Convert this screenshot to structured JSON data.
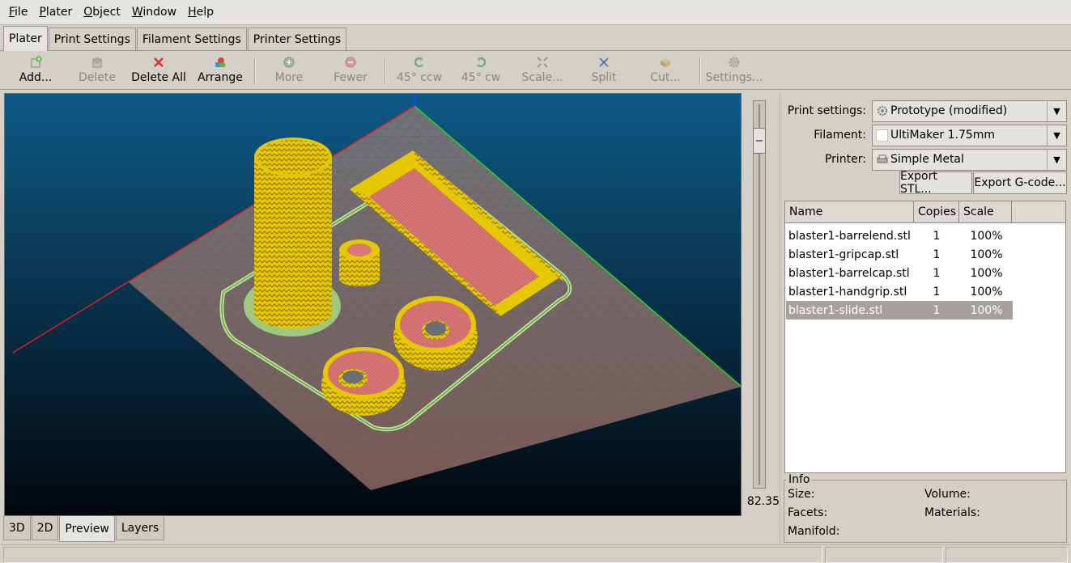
{
  "menu": [
    {
      "u": "F",
      "rest": "ile"
    },
    {
      "u": "P",
      "rest": "later"
    },
    {
      "u": "O",
      "rest": "bject"
    },
    {
      "u": "W",
      "rest": "indow"
    },
    {
      "u": "H",
      "rest": "elp"
    }
  ],
  "top_tabs": [
    "Plater",
    "Print Settings",
    "Filament Settings",
    "Printer Settings"
  ],
  "toolbar": {
    "add": "Add...",
    "delete": "Delete",
    "delete_all": "Delete All",
    "arrange": "Arrange",
    "more": "More",
    "fewer": "Fewer",
    "rot_ccw": "45° ccw",
    "rot_cw": "45° cw",
    "scale": "Scale...",
    "split": "Split",
    "cut": "Cut...",
    "settings": "Settings..."
  },
  "slider": {
    "value": "82.35"
  },
  "view_tabs": [
    "3D",
    "2D",
    "Preview",
    "Layers"
  ],
  "settings": {
    "print_label": "Print settings:",
    "print_value": "Prototype (modified)",
    "filament_label": "Filament:",
    "filament_value": "UltiMaker 1.75mm",
    "printer_label": "Printer:",
    "printer_value": "Simple Metal",
    "export_stl": "Export STL...",
    "export_gcode": "Export G-code..."
  },
  "objects": {
    "headers": {
      "name": "Name",
      "copies": "Copies",
      "scale": "Scale"
    },
    "rows": [
      {
        "name": "blaster1-barrelend.stl",
        "copies": "1",
        "scale": "100%"
      },
      {
        "name": "blaster1-gripcap.stl",
        "copies": "1",
        "scale": "100%"
      },
      {
        "name": "blaster1-barrelcap.stl",
        "copies": "1",
        "scale": "100%"
      },
      {
        "name": "blaster1-handgrip.stl",
        "copies": "1",
        "scale": "100%"
      },
      {
        "name": "blaster1-slide.stl",
        "copies": "1",
        "scale": "100%"
      }
    ],
    "selected_index": 4
  },
  "info": {
    "title": "Info",
    "size": "Size:",
    "volume": "Volume:",
    "facets": "Facets:",
    "materials": "Materials:",
    "manifold": "Manifold:"
  },
  "colors": {
    "extrusion": "#e6c800",
    "infill": "#d97878",
    "skirt": "#b5e38f",
    "bed": "#6b6e74",
    "bg_top": "#0e5a86",
    "bg_bottom": "#02070d"
  }
}
